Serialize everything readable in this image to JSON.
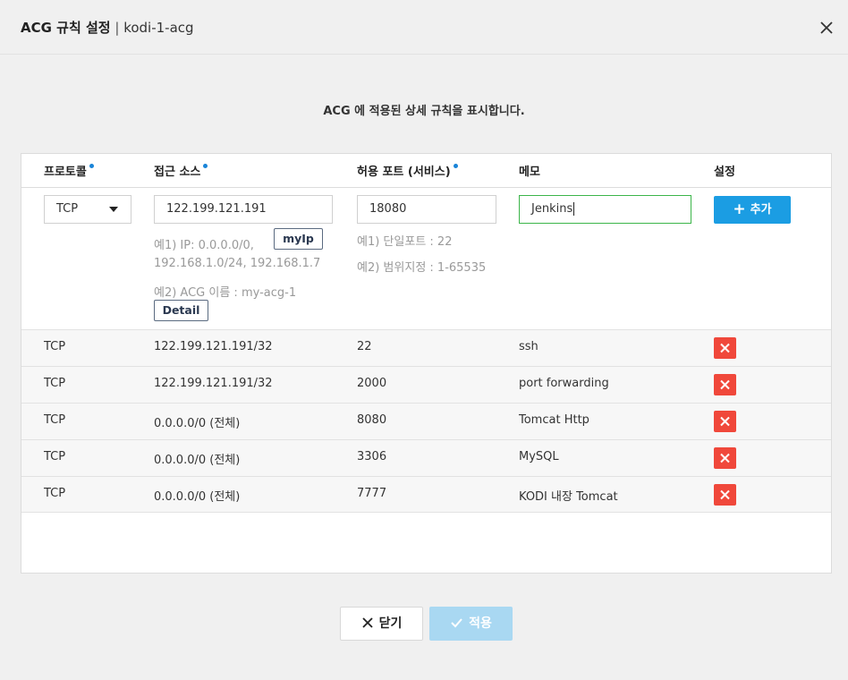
{
  "dialog": {
    "title": "ACG 규칙 설정",
    "separator": "|",
    "subtitle": "kodi-1-acg",
    "description": "ACG 에 적용된 상세 규칙을 표시합니다."
  },
  "columns": [
    "프로토콜",
    "접근 소스",
    "허용 포트 (서비스)",
    "메모",
    "설정"
  ],
  "form": {
    "protocol": "TCP",
    "source": "122.199.121.191",
    "source_hint1_line1": "예1) IP: 0.0.0.0/0,",
    "source_hint1_line2": "192.168.1.0/24, 192.168.1.7",
    "source_hint2": "예2) ACG 이름 : my-acg-1",
    "myip_label": "myIp",
    "detail_label": "Detail",
    "port": "18080",
    "port_hint1": "예1) 단일포트 : 22",
    "port_hint2": "예2) 범위지정 : 1-65535",
    "memo": "Jenkins",
    "add_label": "추가"
  },
  "rules": [
    {
      "protocol": "TCP",
      "source": "122.199.121.191/32",
      "port": "22",
      "memo": "ssh"
    },
    {
      "protocol": "TCP",
      "source": "122.199.121.191/32",
      "port": "2000",
      "memo": "port forwarding"
    },
    {
      "protocol": "TCP",
      "source": "0.0.0.0/0 (전체)",
      "port": "8080",
      "memo": "Tomcat Http"
    },
    {
      "protocol": "TCP",
      "source": "0.0.0.0/0 (전체)",
      "port": "3306",
      "memo": "MySQL"
    },
    {
      "protocol": "TCP",
      "source": "0.0.0.0/0 (전체)",
      "port": "7777",
      "memo": "KODI 내장 Tomcat"
    }
  ],
  "footer": {
    "close_label": "닫기",
    "apply_label": "적용"
  },
  "colors": {
    "primary": "#1b9de3",
    "delete": "#f0483b",
    "focus": "#3cb54a",
    "apply_disabled": "#a9d8f2"
  },
  "icons": {
    "close": "close-icon",
    "plus": "plus-icon",
    "delete": "x-icon",
    "caret": "caret-down-icon",
    "check": "check-icon"
  }
}
